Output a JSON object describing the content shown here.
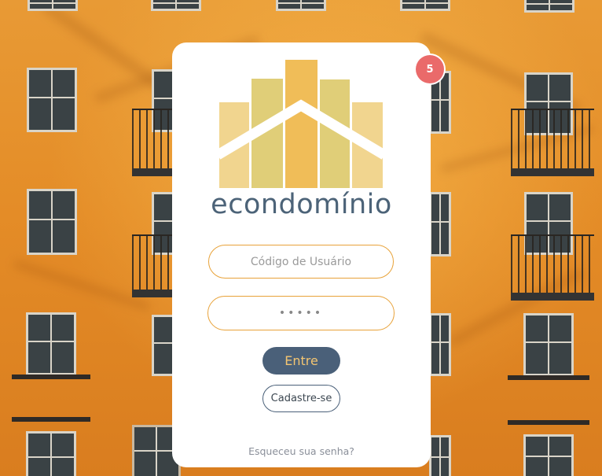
{
  "brand": {
    "name": "econdomínio"
  },
  "notification_badge": {
    "count": "5",
    "color": "#ea6a6a"
  },
  "login_form": {
    "user_code_placeholder": "Código de Usuário",
    "password_value": "•••••"
  },
  "buttons": {
    "enter_label": "Entre",
    "register_label": "Cadastre-se"
  },
  "forgot_password_link": "Esqueceu sua senha?",
  "colors": {
    "accent_orange": "#e8a239",
    "primary_blue": "#4a6079",
    "logo_yellow": "#efc15a",
    "background_wall": "#e48c27"
  }
}
